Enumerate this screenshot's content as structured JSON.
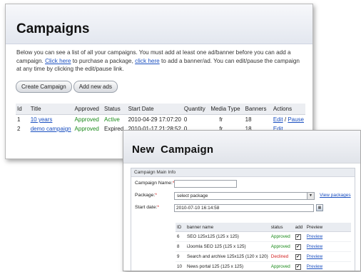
{
  "campaigns_panel": {
    "title": "Campaigns",
    "intro": {
      "part1": "Below you can see a list of all your campaigns. You must add at least one ad/banner before you can add a campaign. ",
      "link1": "Click here",
      "part2": " to purchase a package, ",
      "link2": "click here",
      "part3": " to add a banner/ad. You can edit/pause the campaign at any time by clicking the edit/pause link."
    },
    "buttons": {
      "create": "Create Campaign",
      "add_ads": "Add new ads"
    },
    "table": {
      "headers": [
        "Id",
        "Title",
        "Approved",
        "Status",
        "Start Date",
        "Quantity",
        "Media Type",
        "Banners",
        "Actions"
      ],
      "rows": [
        {
          "id": "1",
          "title": "10 years",
          "approved": "Approved",
          "status": "Active",
          "start_date": "2010-04-29 17:07:20",
          "quantity": "0",
          "media_type": "fr",
          "banners": "18",
          "action_edit": "Edit",
          "action_sep": " / ",
          "action_pause": "Pause"
        },
        {
          "id": "2",
          "title": "demo campaign",
          "approved": "Approved",
          "status": "Expired",
          "start_date": "2010-01-17 21:28:52",
          "quantity": "0",
          "media_type": "fr",
          "banners": "18",
          "action_edit": "Edit"
        }
      ]
    }
  },
  "new_campaign_panel": {
    "title": "New  Campaign",
    "section_title": "Campaign Main Info",
    "fields": {
      "name_label": "Campaign Name:",
      "name_value": "",
      "package_label": "Package:",
      "package_value": "select package",
      "view_packages": "View packages",
      "start_label": "Start date:",
      "start_value": "2010-07-10 16:14:58",
      "required_mark": "*"
    },
    "banners": {
      "headers": [
        "ID",
        "banner name",
        "status",
        "add",
        "Preview"
      ],
      "rows": [
        {
          "id": "6",
          "name": "SEO 125x125 (125 x 125)",
          "status": "Approved",
          "status_color": "#1a8a1a",
          "checked": true,
          "preview": "Preview"
        },
        {
          "id": "8",
          "name": "iJoomla SEO 125 (125 x 125)",
          "status": "Approved",
          "status_color": "#1a8a1a",
          "checked": true,
          "preview": "Preview"
        },
        {
          "id": "9",
          "name": "Search and archive 125x125 (120 x 120)",
          "status": "Declined",
          "status_color": "#d21d1d",
          "checked": true,
          "preview": "Preview"
        },
        {
          "id": "10",
          "name": "News portal 125 (125 x 125)",
          "status": "Approved",
          "status_color": "#1a8a1a",
          "checked": true,
          "preview": "Preview"
        }
      ]
    }
  }
}
